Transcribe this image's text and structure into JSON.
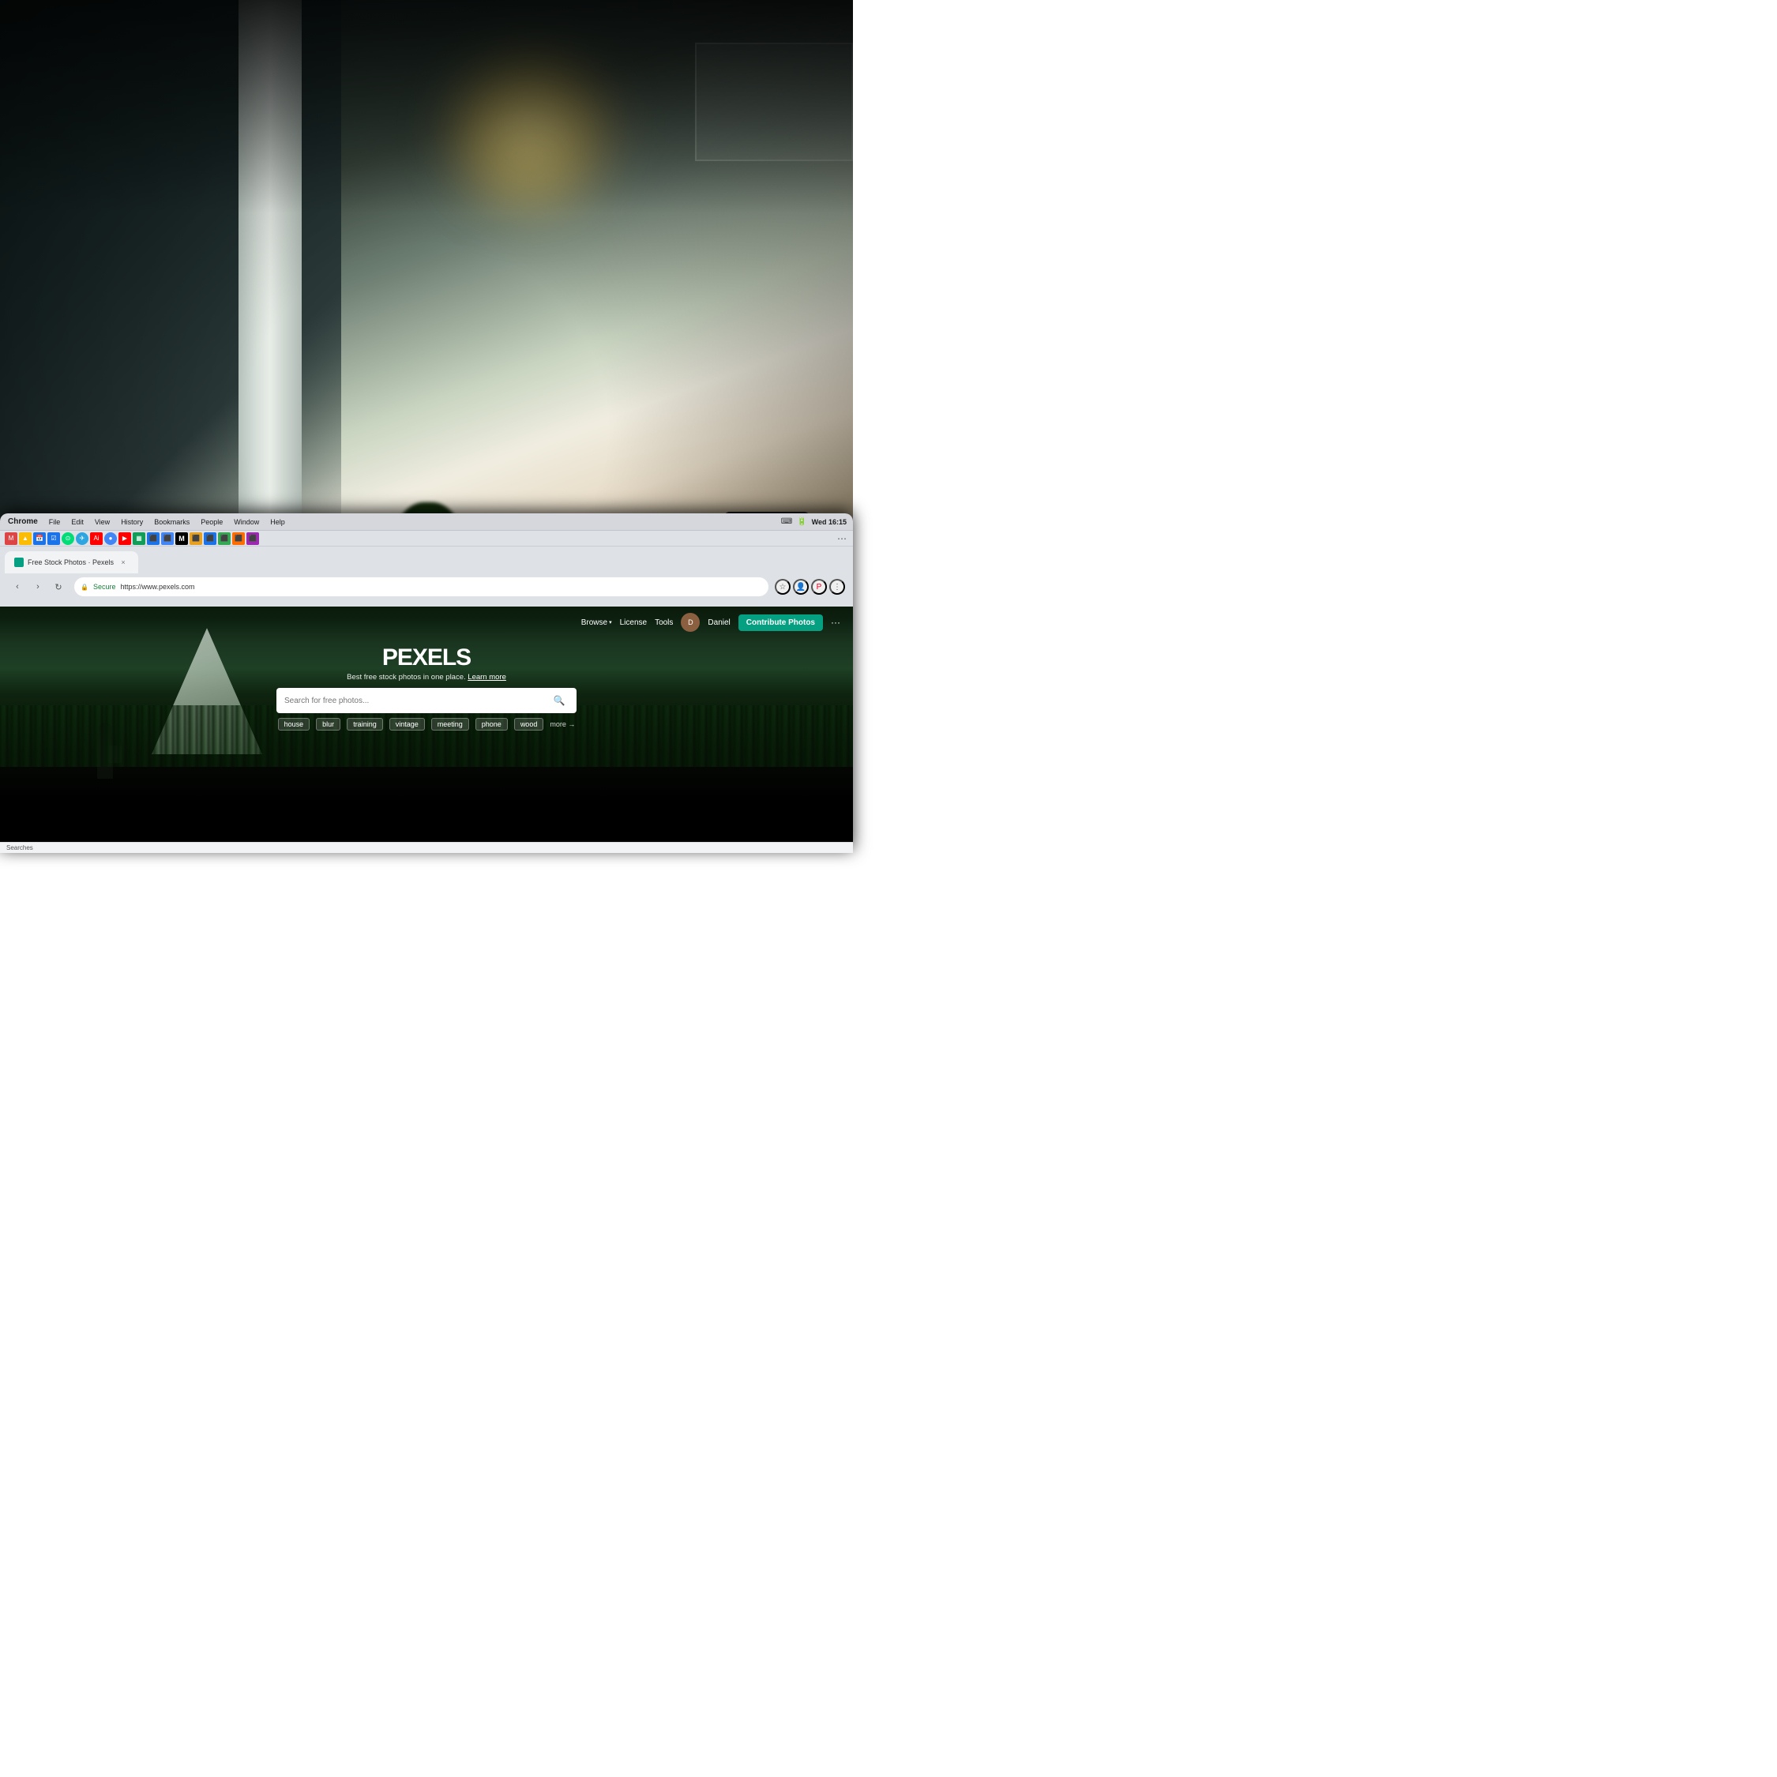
{
  "background": {
    "type": "office_photo",
    "description": "Office interior with bright window, plants, and dark foreground"
  },
  "screen": {
    "mac_menubar": {
      "app_name": "Chrome",
      "menu_items": [
        "File",
        "Edit",
        "View",
        "History",
        "Bookmarks",
        "People",
        "Window",
        "Help"
      ],
      "right_items": [
        "system_icons",
        "100 %",
        "Wed 16:15"
      ]
    },
    "browser": {
      "tab": {
        "favicon": "pexels",
        "title": "Free Stock Photos · Pexels",
        "close_symbol": "×"
      },
      "address_bar": {
        "secure_label": "Secure",
        "url": "https://www.pexels.com"
      }
    },
    "pexels_site": {
      "nav": {
        "browse": "Browse",
        "license": "License",
        "tools": "Tools",
        "username": "Daniel",
        "contribute_button": "Contribute Photos",
        "more_symbol": "···"
      },
      "hero": {
        "logo": "PEXELS",
        "tagline": "Best free stock photos in one place.",
        "learn_more": "Learn more",
        "search_placeholder": "Search for free photos...",
        "search_icon": "🔍"
      },
      "suggestions": {
        "tags": [
          "house",
          "blur",
          "training",
          "vintage",
          "meeting",
          "phone",
          "wood"
        ],
        "more_label": "more →"
      }
    },
    "status_bar": {
      "text": "Searches"
    }
  },
  "colors": {
    "pexels_green": "#05a081",
    "nav_bg": "transparent",
    "search_bg": "#ffffff",
    "tag_bg": "rgba(255,255,255,0.15)"
  }
}
